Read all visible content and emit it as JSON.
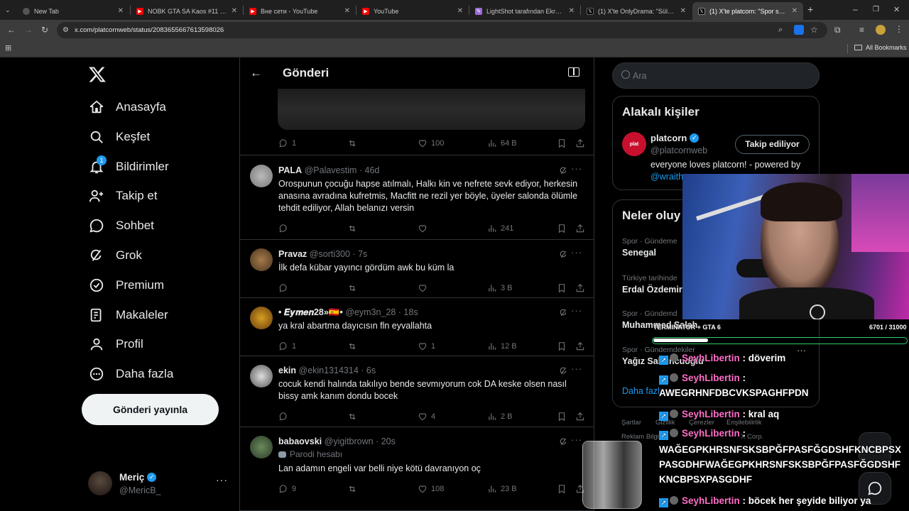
{
  "browser": {
    "tabs": [
      {
        "title": "New Tab",
        "fav": "newtab-icon"
      },
      {
        "title": "NOBK GTA SA Kaos #11 - YouTube",
        "fav": "youtube-icon"
      },
      {
        "title": "Вне сети - YouTube",
        "fav": "youtube-icon"
      },
      {
        "title": "YouTube",
        "fav": "youtube-icon"
      },
      {
        "title": "LightShot tarafından Ekran Görüntüsü",
        "fav": "lightshot-icon"
      },
      {
        "title": "(1) X'te OnlyDrama: \"Süleyman",
        "fav": "x-icon"
      },
      {
        "title": "(1) X'te platcorn: \"Spor salonun",
        "fav": "x-icon"
      }
    ],
    "url": "x.com/platcornweb/status/2083655667613598026",
    "bookmarks_label": "All Bookmarks"
  },
  "nav": {
    "items": [
      {
        "label": "Anasayfa",
        "icon": "home-icon"
      },
      {
        "label": "Keşfet",
        "icon": "search-icon"
      },
      {
        "label": "Bildirimler",
        "icon": "bell-icon"
      },
      {
        "label": "Takip et",
        "icon": "follow-icon"
      },
      {
        "label": "Sohbet",
        "icon": "chat-icon"
      },
      {
        "label": "Grok",
        "icon": "grok-icon"
      },
      {
        "label": "Premium",
        "icon": "premium-icon"
      },
      {
        "label": "Makaleler",
        "icon": "articles-icon"
      },
      {
        "label": "Profil",
        "icon": "profile-icon"
      },
      {
        "label": "Daha fazla",
        "icon": "more-icon"
      }
    ],
    "notif_count": "1",
    "post_button": "Gönderi yayınla",
    "account": {
      "name": "Meriç",
      "handle": "@MericB_"
    }
  },
  "main": {
    "title": "Gönderi",
    "top_actions": {
      "replies": "1",
      "likes": "100",
      "views": "64 B"
    },
    "posts": [
      {
        "name": "PALA",
        "handle": "@Palavestim",
        "time": "46d",
        "text": "Orospunun çocuğu hapse atılmalı, Halkı kin ve nefrete sevk ediyor, herkesin anasına avradına kufretmis, Macfitt ne rezil yer böyle, üyeler salonda ölümle tehdit ediliyor, Allah belanızı versin",
        "replies": "",
        "likes": "",
        "views": "241"
      },
      {
        "name": "Pravaz",
        "handle": "@sorti300",
        "time": "7s",
        "text": "İlk defa kübar yayıncı gördüm awk bu küm la",
        "replies": "",
        "likes": "",
        "views": "3 B"
      },
      {
        "name": "• 𝑬𝒚𝒎𝒆𝒏28»🇪🇸•",
        "handle": "@eym3n_28",
        "time": "18s",
        "text": "ya kral abartma dayıcısın fln eyvallahta",
        "replies": "1",
        "likes": "1",
        "views": "12 B"
      },
      {
        "name": "ekin",
        "handle": "@ekin1314314",
        "time": "6s",
        "text": "cocuk kendi halında takılıyo bende sevmıyorum cok DA keske olsen nasıl bissy amk kanım dondu bocek",
        "replies": "",
        "likes": "4",
        "views": "2 B"
      },
      {
        "name": "babaovski",
        "handle": "@yigitbrown",
        "time": "20s",
        "label": "Parodi hesabı",
        "text": "Lan adamın engeli var belli niye kötü davranıyon oç",
        "replies": "9",
        "likes": "108",
        "views": "23 B"
      }
    ]
  },
  "right": {
    "search_placeholder": "Ara",
    "related_title": "Alakalı kişiler",
    "related": {
      "name": "platcorn",
      "handle": "@platcornweb",
      "button": "Takip ediliyor",
      "bio": "everyone loves platcorn! - powered by",
      "bio_link": "@wraith"
    },
    "trends_title": "Neler oluy",
    "trends": [
      {
        "meta": "Spor · Gündeme",
        "name": "Senegal"
      },
      {
        "meta": "Türkiye tarihinde",
        "name": "Erdal Özdemir"
      },
      {
        "meta": "Spor · Gündemd",
        "name": "Muhammed Salah"
      },
      {
        "meta": "Spor · Gündemdekiler",
        "name": "Yağız Sabuncuoğlu"
      }
    ],
    "show_more": "Daha fazl",
    "footer": [
      "Şartlar",
      "Gizlilik",
      "Çerezler",
      "Erişilebilirlik",
      "Reklam Bilgi",
      "X Corp."
    ]
  },
  "overlay": {
    "progress_label": "TERMINATOR + GTA 6",
    "progress_value": "6701 / 31000",
    "progress_fraction": 0.216,
    "chat": [
      {
        "user": "SeyhLibertin",
        "msg": ": döverim"
      },
      {
        "user": "SeyhLibertin",
        "msg": ":"
      },
      {
        "user": "",
        "msg": "AWEGRHNFDBCVKSPAGHFPDN"
      },
      {
        "user": "SeyhLibertin",
        "msg": ": kral aq"
      },
      {
        "user": "SeyhLibertin",
        "msg": ":"
      },
      {
        "user": "",
        "msg": "WAĞEGPKHRSNFSKSBPĞFPASFĞGDSHFKNCBPSX"
      },
      {
        "user": "",
        "msg": "PASGDHFWAĞEGPKHRSNFSKSBPĞFPASFĞGDSHF"
      },
      {
        "user": "",
        "msg": "KNCBPSXPASGDHF"
      },
      {
        "user": "SeyhLibertin",
        "msg": ": böcek her şeyide biliyor ya"
      }
    ]
  }
}
